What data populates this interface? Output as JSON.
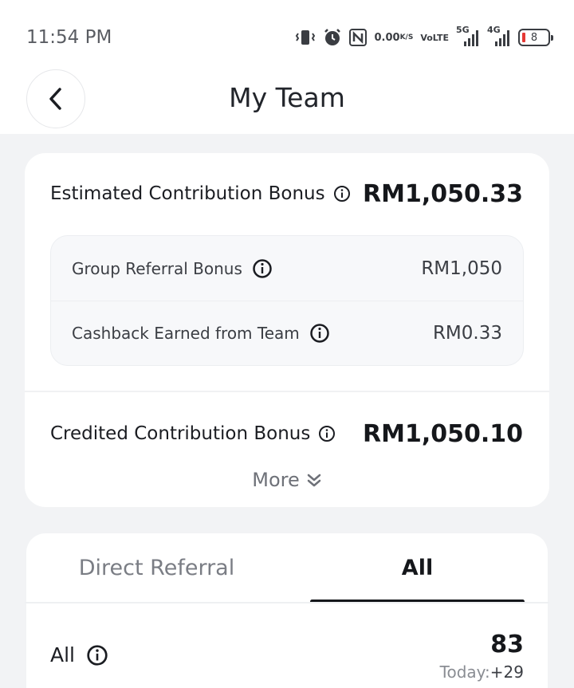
{
  "status_bar": {
    "time": "11:54 PM",
    "net_speed_value": "0.00",
    "net_speed_unit": "K/S",
    "volte_top": "Vo",
    "volte_bottom": "LTE",
    "sig1_label": "5G",
    "sig2_label": "4G",
    "battery": "8"
  },
  "header": {
    "title": "My Team"
  },
  "bonus": {
    "estimated_label": "Estimated Contribution Bonus",
    "estimated_amount": "RM1,050.33",
    "group_referral_label": "Group Referral Bonus",
    "group_referral_amount": "RM1,050",
    "cashback_label": "Cashback Earned from Team",
    "cashback_amount": "RM0.33",
    "credited_label": "Credited Contribution Bonus",
    "credited_amount": "RM1,050.10",
    "more_label": "More"
  },
  "team": {
    "tabs": [
      {
        "label": "Direct Referral",
        "active": false
      },
      {
        "label": "All",
        "active": true
      }
    ],
    "count_label": "All",
    "count_value": "83",
    "today_prefix": "Today:",
    "today_delta": "+29"
  },
  "colors": {
    "background": "#f2f3f5",
    "card": "#ffffff",
    "text_primary": "#15171b",
    "text_secondary": "#7a7d84",
    "battery_low": "#e53935"
  }
}
